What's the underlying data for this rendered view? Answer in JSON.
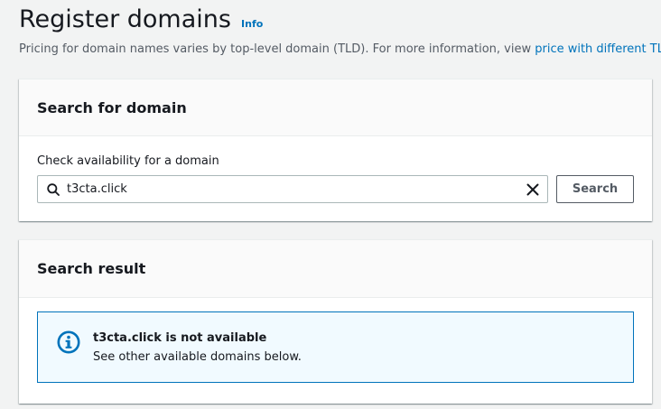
{
  "header": {
    "title": "Register domains",
    "info_label": "Info",
    "description_text": "Pricing for domain names varies by top-level domain (TLD). For more information, view ",
    "description_link": "price with different TLDs"
  },
  "search_section": {
    "title": "Search for domain",
    "field_label": "Check availability for a domain",
    "input_value": "t3cta.click",
    "button_label": "Search",
    "icons": {
      "search": "search-icon",
      "clear": "close-icon"
    }
  },
  "result_section": {
    "title": "Search result",
    "alert": {
      "icon": "info-icon",
      "title": "t3cta.click is not available",
      "message": "See other available domains below."
    }
  },
  "colors": {
    "link": "#0073bb",
    "info_border": "#0073bb",
    "info_background": "#f1faff",
    "page_background": "#f2f3f3"
  }
}
